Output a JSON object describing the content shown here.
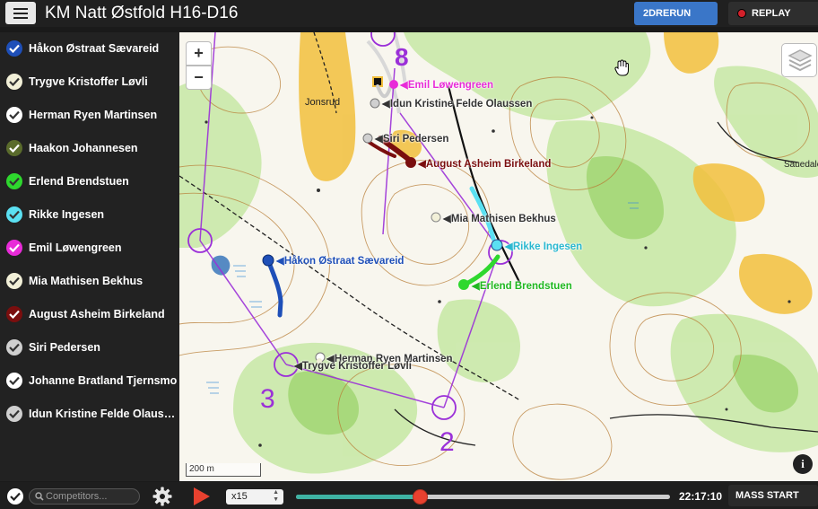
{
  "header": {
    "title": "KM Natt Østfold H16-D16",
    "rerun_label": "2DRERUN",
    "replay_label": "REPLAY",
    "replay_dot_color": "#d2202a"
  },
  "runners": [
    {
      "name": "Håkon Østraat Sævareid",
      "color": "#1e4fb8",
      "check": "#ffffff"
    },
    {
      "name": "Trygve Kristoffer Løvli",
      "color": "#f2f0d8",
      "check": "#333333"
    },
    {
      "name": "Herman Ryen Martinsen",
      "color": "#ffffff",
      "check": "#333333"
    },
    {
      "name": "Haakon Johannesen",
      "color": "#5a6b2c",
      "check": "#ffffff"
    },
    {
      "name": "Erlend Brendstuen",
      "color": "#2ed82e",
      "check": "#333333"
    },
    {
      "name": "Rikke Ingesen",
      "color": "#5be0f2",
      "check": "#333333"
    },
    {
      "name": "Emil Løwengreen",
      "color": "#e82bd8",
      "check": "#ffffff"
    },
    {
      "name": "Mia Mathisen Bekhus",
      "color": "#f2f0d8",
      "check": "#333333"
    },
    {
      "name": "August Asheim Birkeland",
      "color": "#7a0e0e",
      "check": "#ffffff"
    },
    {
      "name": "Siri Pedersen",
      "color": "#d0d0d0",
      "check": "#333333"
    },
    {
      "name": "Johanne Bratland Tjernsmo",
      "color": "#ffffff",
      "check": "#333333"
    },
    {
      "name": "Idun Kristine Felde Olaussen",
      "color": "#d0d0d0",
      "check": "#333333"
    }
  ],
  "map": {
    "zoom_in": "+",
    "zoom_out": "−",
    "scale": "200 m",
    "info": "i",
    "course_color": "#9b30d8",
    "control_numbers": [
      "8",
      "3",
      "2"
    ],
    "runner_labels": [
      {
        "name": "Emil Løwengreen",
        "color": "#e82bd8"
      },
      {
        "name": "Idun Kristine Felde Olaussen",
        "color": "#d0d0d0"
      },
      {
        "name": "Siri Pedersen",
        "color": "#d0d0d0"
      },
      {
        "name": "August Asheim Birkeland",
        "color": "#7a0e0e"
      },
      {
        "name": "Mia Mathisen Bekhus",
        "color": "#f2f0d8"
      },
      {
        "name": "Rikke Ingesen",
        "color": "#5be0f2"
      },
      {
        "name": "Erlend Brendstuen",
        "color": "#2ed82e"
      },
      {
        "name": "Håkon Østraat Sævareid",
        "color": "#1e4fb8"
      },
      {
        "name": "Herman Ryen Martinsen",
        "color": "#ffffff"
      },
      {
        "name": "Trygve Kristoffer Løvli",
        "color": "#f2f0d8"
      }
    ],
    "place_names": [
      "Jonsrud",
      "Sauedalen"
    ]
  },
  "footer": {
    "search_placeholder": "Competitors...",
    "speed": "x15",
    "progress": 0.33,
    "clock": "22:17:10",
    "mass_start_label": "MASS START"
  }
}
